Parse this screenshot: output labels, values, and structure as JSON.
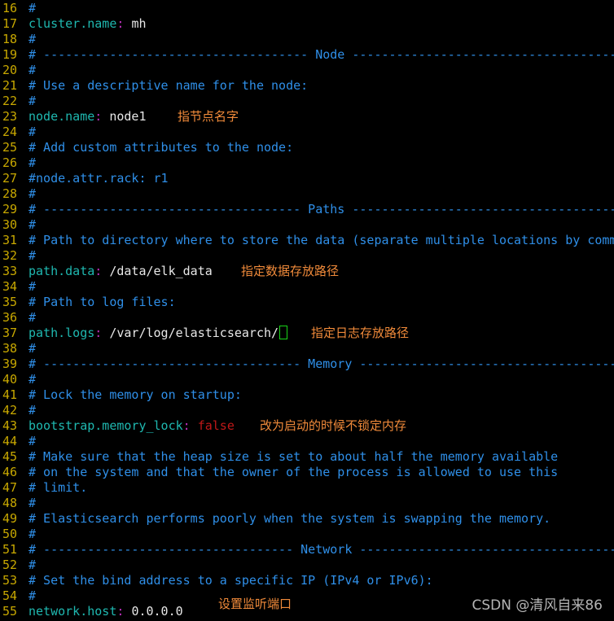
{
  "terminal": {
    "colors": {
      "line_number": "#c8a800",
      "comment": "#2f8fe8",
      "key": "#1fb8b0",
      "colon": "#c030c0",
      "value": "#e8e8e8",
      "false": "#c01818",
      "annotation": "#f08a3a",
      "cursor": "#19d419"
    },
    "lines": [
      {
        "n": "16",
        "comment": "#"
      },
      {
        "n": "17",
        "key": "cluster.name",
        "value": "mh"
      },
      {
        "n": "18",
        "comment": "#"
      },
      {
        "n": "19",
        "comment": "# ------------------------------------ Node ------------------------------------"
      },
      {
        "n": "20",
        "comment": "#"
      },
      {
        "n": "21",
        "comment": "# Use a descriptive name for the node:"
      },
      {
        "n": "22",
        "comment": "#"
      },
      {
        "n": "23",
        "key": "node.name",
        "value": "node1",
        "note": "指节点名字"
      },
      {
        "n": "24",
        "comment": "#"
      },
      {
        "n": "25",
        "comment": "# Add custom attributes to the node:"
      },
      {
        "n": "26",
        "comment": "#"
      },
      {
        "n": "27",
        "comment": "#node.attr.rack: r1"
      },
      {
        "n": "28",
        "comment": "#"
      },
      {
        "n": "29",
        "comment": "# ----------------------------------- Paths ------------------------------------"
      },
      {
        "n": "30",
        "comment": "#"
      },
      {
        "n": "31",
        "comment": "# Path to directory where to store the data (separate multiple locations by comma):"
      },
      {
        "n": "32",
        "comment": "#"
      },
      {
        "n": "33",
        "key": "path.data",
        "value": "/data/elk_data",
        "note": "指定数据存放路径"
      },
      {
        "n": "34",
        "comment": "#"
      },
      {
        "n": "35",
        "comment": "# Path to log files:"
      },
      {
        "n": "36",
        "comment": "#"
      },
      {
        "n": "37",
        "key": "path.logs",
        "value": "/var/log/elasticsearch/",
        "cursor": true,
        "note": "指定日志存放路径"
      },
      {
        "n": "38",
        "comment": "#"
      },
      {
        "n": "39",
        "comment": "# ----------------------------------- Memory -----------------------------------"
      },
      {
        "n": "40",
        "comment": "#"
      },
      {
        "n": "41",
        "comment": "# Lock the memory on startup:"
      },
      {
        "n": "42",
        "comment": "#"
      },
      {
        "n": "43",
        "key": "bootstrap.memory_lock",
        "value_red": "false",
        "note": "改为启动的时候不锁定内存"
      },
      {
        "n": "44",
        "comment": "#"
      },
      {
        "n": "45",
        "comment": "# Make sure that the heap size is set to about half the memory available"
      },
      {
        "n": "46",
        "comment": "# on the system and that the owner of the process is allowed to use this"
      },
      {
        "n": "47",
        "comment": "# limit."
      },
      {
        "n": "48",
        "comment": "#"
      },
      {
        "n": "49",
        "comment": "# Elasticsearch performs poorly when the system is swapping the memory."
      },
      {
        "n": "50",
        "comment": "#"
      },
      {
        "n": "51",
        "comment": "# ---------------------------------- Network -----------------------------------"
      },
      {
        "n": "52",
        "comment": "#"
      },
      {
        "n": "53",
        "comment": "# Set the bind address to a specific IP (IPv4 or IPv6):"
      },
      {
        "n": "54",
        "comment": "#"
      },
      {
        "n": "55",
        "key": "network.host",
        "value": "0.0.0.0",
        "note": "设置监听端口"
      }
    ]
  },
  "watermark": "CSDN @清风自来86"
}
